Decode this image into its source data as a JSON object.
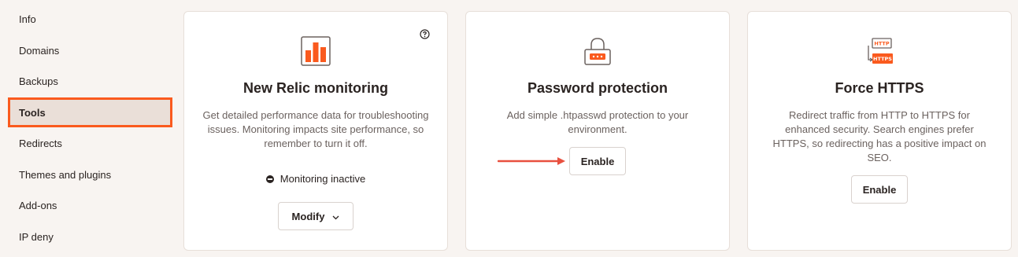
{
  "sidebar": {
    "items": [
      {
        "label": "Info"
      },
      {
        "label": "Domains"
      },
      {
        "label": "Backups"
      },
      {
        "label": "Tools"
      },
      {
        "label": "Redirects"
      },
      {
        "label": "Themes and plugins"
      },
      {
        "label": "Add-ons"
      },
      {
        "label": "IP deny"
      }
    ],
    "active_index": 3
  },
  "cards": {
    "new_relic": {
      "icon": "bar-chart-icon",
      "title": "New Relic monitoring",
      "description": "Get detailed performance data for troubleshooting issues. Monitoring impacts site performance, so remember to turn it off.",
      "status": "Monitoring inactive",
      "button_label": "Modify"
    },
    "password": {
      "icon": "lock-icon",
      "title": "Password protection",
      "description": "Add simple .htpasswd protection to your environment.",
      "button_label": "Enable"
    },
    "https": {
      "icon": "http-https-icon",
      "title": "Force HTTPS",
      "description": "Redirect traffic from HTTP to HTTPS for enhanced security. Search engines prefer HTTPS, so redirecting has a positive impact on SEO.",
      "button_label": "Enable",
      "icon_labels": {
        "top": "HTTP",
        "bottom": "HTTPS"
      }
    }
  },
  "colors": {
    "accent": "#fa5a1e",
    "arrow": "#e8503f"
  }
}
